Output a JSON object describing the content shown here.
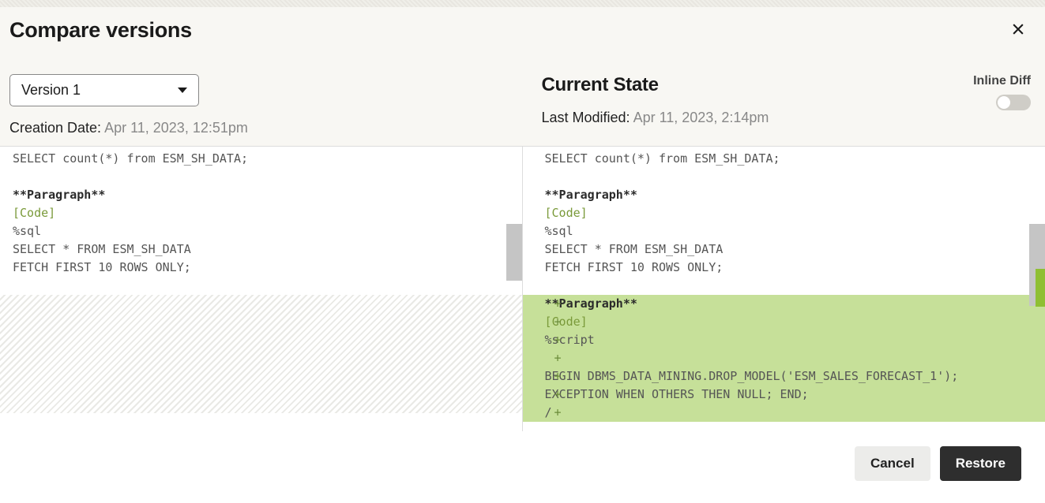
{
  "dialog": {
    "title": "Compare versions"
  },
  "left": {
    "version_label": "Version 1",
    "meta_label": "Creation Date: ",
    "meta_value": "Apr 11, 2023, 12:51pm",
    "lines": [
      {
        "t": "SELECT count(*) from ESM_SH_DATA;",
        "cls": ""
      },
      {
        "t": " ",
        "cls": ""
      },
      {
        "t": "**Paragraph**",
        "cls": "para-h"
      },
      {
        "t": "[Code]",
        "cls": "code-tag"
      },
      {
        "t": "%sql",
        "cls": ""
      },
      {
        "t": "SELECT * FROM ESM_SH_DATA",
        "cls": ""
      },
      {
        "t": "FETCH FIRST 10 ROWS ONLY;",
        "cls": ""
      },
      {
        "t": " ",
        "cls": ""
      }
    ]
  },
  "right": {
    "heading": "Current State",
    "meta_label": "Last Modified: ",
    "meta_value": "Apr 11, 2023, 2:14pm",
    "lines": [
      {
        "t": "SELECT count(*) from ESM_SH_DATA;",
        "cls": ""
      },
      {
        "t": " ",
        "cls": ""
      },
      {
        "t": "**Paragraph**",
        "cls": "para-h"
      },
      {
        "t": "[Code]",
        "cls": "code-tag"
      },
      {
        "t": "%sql",
        "cls": ""
      },
      {
        "t": "SELECT * FROM ESM_SH_DATA",
        "cls": ""
      },
      {
        "t": "FETCH FIRST 10 ROWS ONLY;",
        "cls": ""
      },
      {
        "t": " ",
        "cls": ""
      }
    ],
    "added_lines": [
      {
        "t": "**Paragraph**",
        "cls": "para-h"
      },
      {
        "t": "[Code]",
        "cls": "code-tag"
      },
      {
        "t": "%script",
        "cls": ""
      },
      {
        "t": "",
        "cls": ""
      },
      {
        "t": "BEGIN DBMS_DATA_MINING.DROP_MODEL('ESM_SALES_FORECAST_1');",
        "cls": ""
      },
      {
        "t": "EXCEPTION WHEN OTHERS THEN NULL; END;",
        "cls": ""
      },
      {
        "t": "/",
        "cls": ""
      }
    ]
  },
  "inline_diff_label": "Inline Diff",
  "buttons": {
    "cancel": "Cancel",
    "restore": "Restore"
  }
}
